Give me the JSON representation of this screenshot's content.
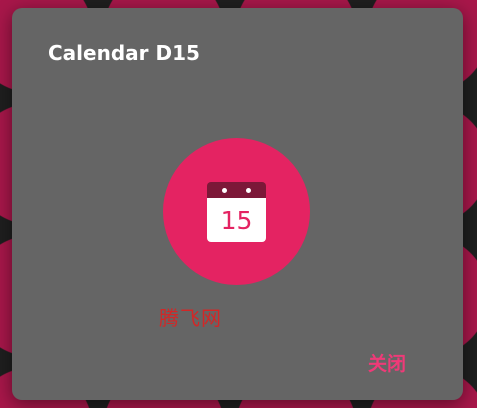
{
  "dialog": {
    "title": "Calendar D15",
    "close_label": "关闭"
  },
  "icon": {
    "name": "calendar-icon",
    "day": "15"
  },
  "watermark": {
    "text": "腾飞网"
  },
  "colors": {
    "accent": "#e42362",
    "calendar_header": "#7c1838",
    "dialog_background": "#656565",
    "backdrop_dots": "#a8174a",
    "backdrop": "#1f1f1f",
    "close_text": "#ef3a78",
    "watermark_text": "#d22727"
  }
}
